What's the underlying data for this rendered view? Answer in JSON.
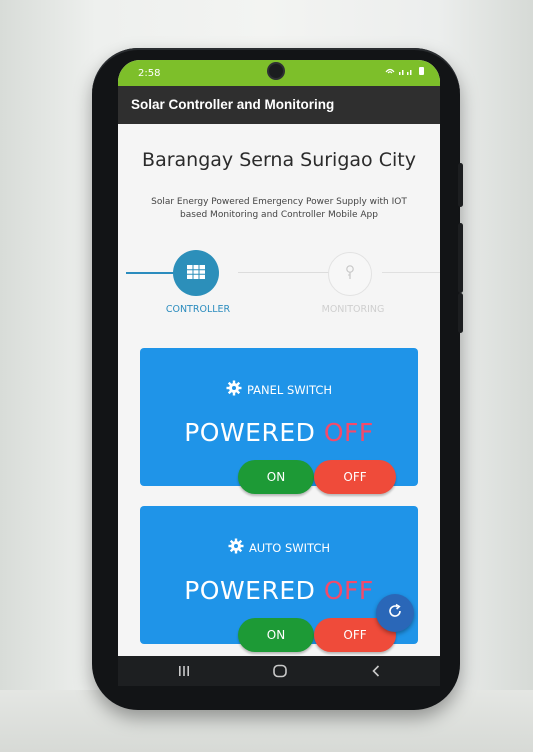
{
  "status_bar": {
    "time": "2:58",
    "color": "#7dbf2a"
  },
  "app_bar": {
    "title": "Solar Controller and Monitoring"
  },
  "page": {
    "title": "Barangay Serna Surigao City",
    "subtitle": "Solar Energy Powered Emergency Power Supply with IOT based Monitoring and Controller Mobile App"
  },
  "stepper": {
    "steps": [
      {
        "label": "CONTROLLER",
        "icon": "grid-icon",
        "active": true
      },
      {
        "label": "MONITORING",
        "icon": "antenna-icon",
        "active": false
      }
    ]
  },
  "cards": [
    {
      "title": "PANEL SWITCH",
      "icon": "gear-icon",
      "status_prefix": "POWERED",
      "status_value": "OFF",
      "on_label": "ON",
      "off_label": "OFF"
    },
    {
      "title": "AUTO SWITCH",
      "icon": "gear-icon",
      "status_prefix": "POWERED",
      "status_value": "OFF",
      "on_label": "ON",
      "off_label": "OFF"
    }
  ],
  "fab": {
    "icon": "refresh-icon"
  },
  "system_nav": {
    "buttons": [
      "recents-icon",
      "home-icon",
      "back-icon"
    ]
  },
  "colors": {
    "card": "#1f94e8",
    "off_text": "#f44a6a",
    "on_button": "#1d9a36",
    "off_button": "#ef4b3a",
    "accent": "#2b8cbe"
  }
}
